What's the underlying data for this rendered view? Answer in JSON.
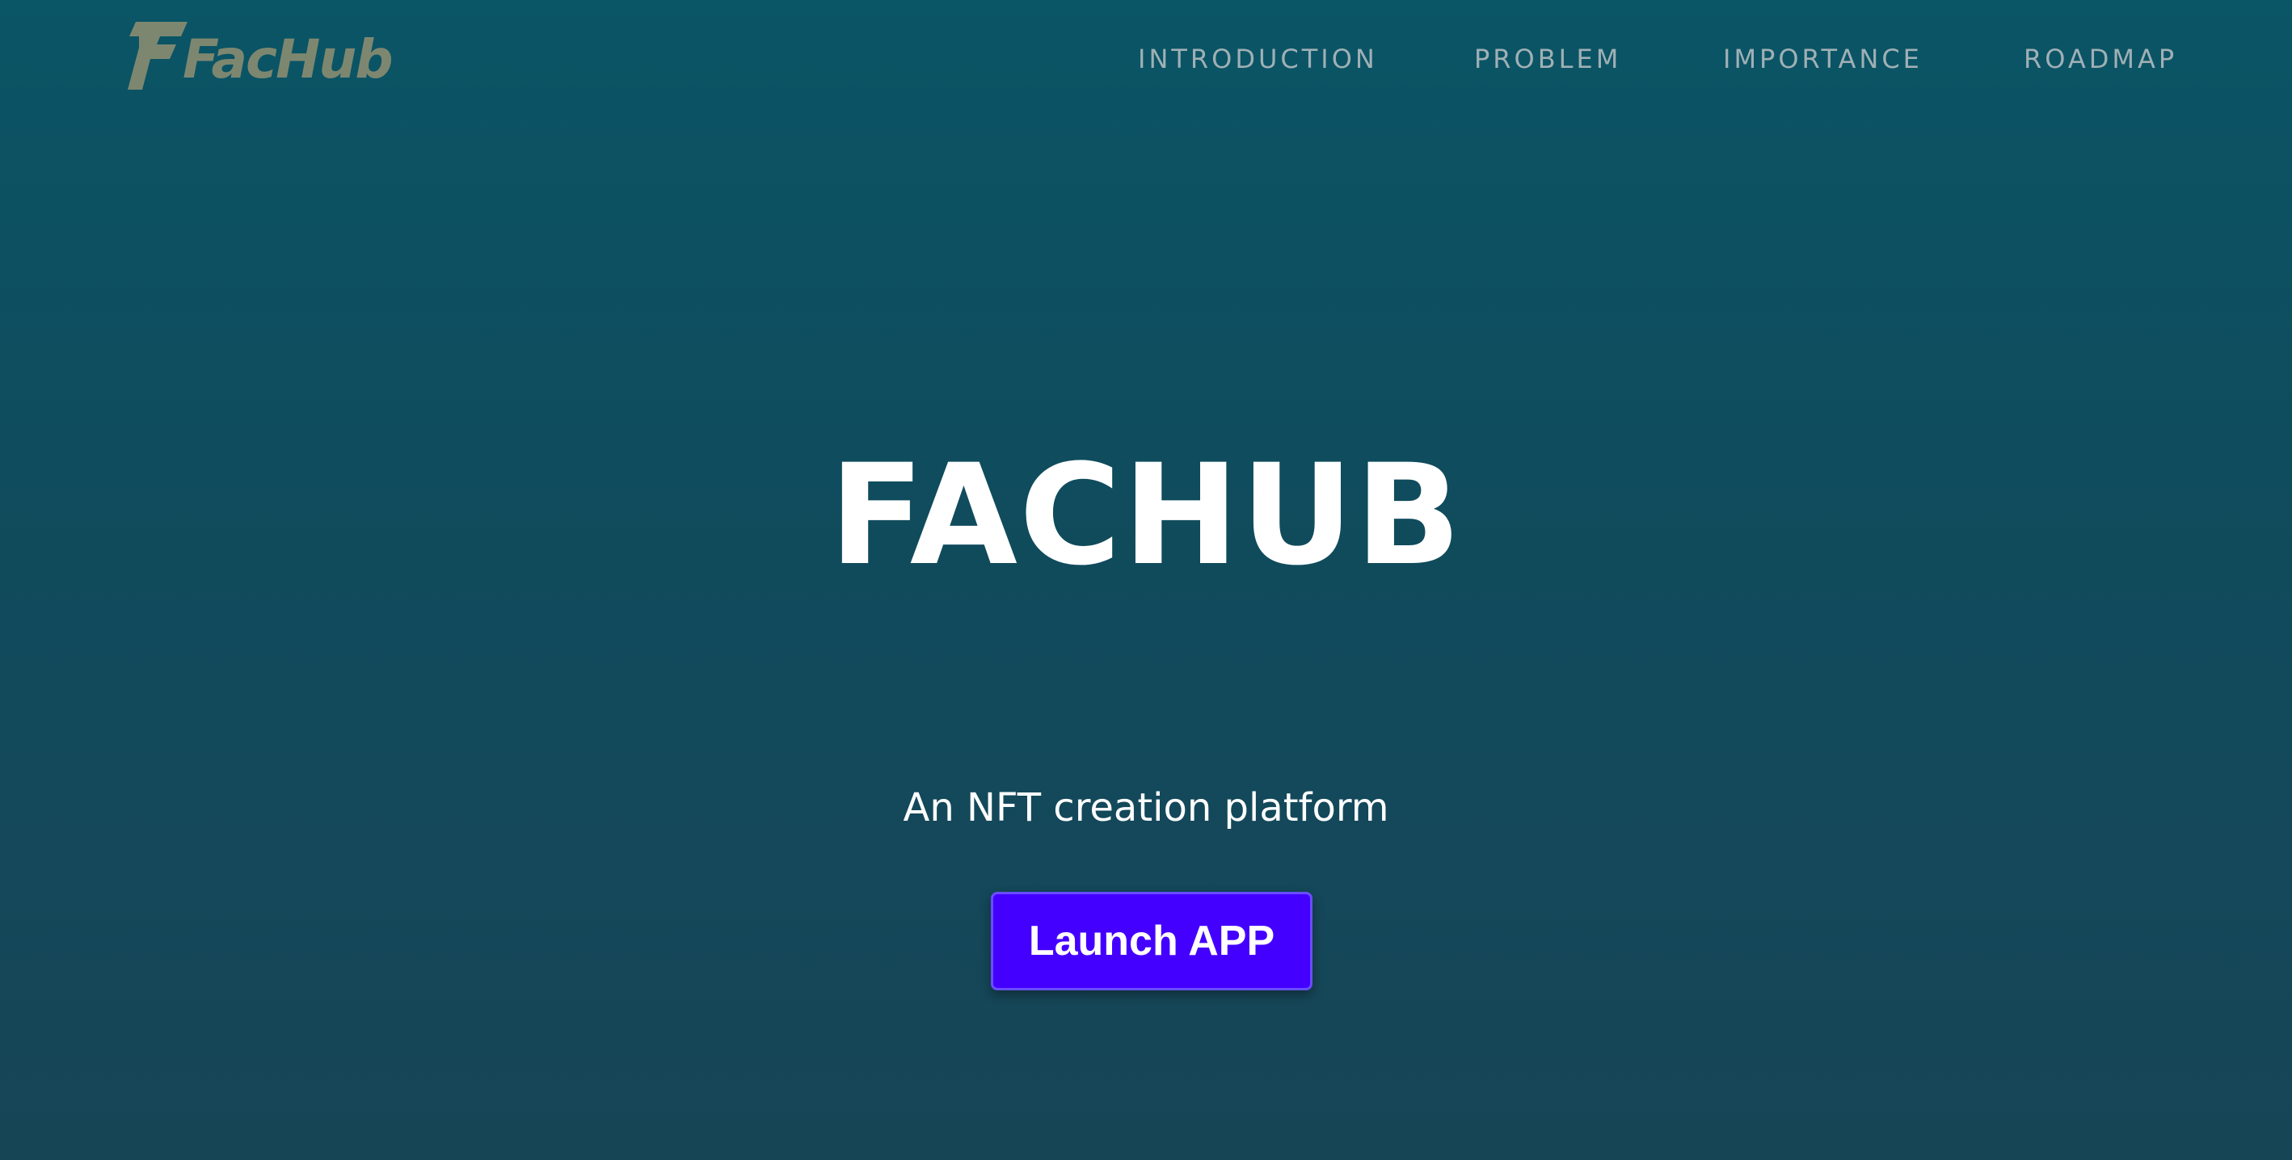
{
  "header": {
    "logo": {
      "text": "FacHub",
      "icon": "fachub-logo-icon",
      "color": "#7d8770"
    },
    "nav": [
      {
        "label": "INTRODUCTION"
      },
      {
        "label": "PROBLEM"
      },
      {
        "label": "IMPORTANCE"
      },
      {
        "label": "ROADMAP"
      }
    ]
  },
  "hero": {
    "title": "FACHUB",
    "subtitle": "An NFT creation platform",
    "cta_label": "Launch APP"
  },
  "colors": {
    "background_top": "#0a5566",
    "background_bottom": "#164556",
    "nav_text": "#9fb0b5",
    "cta_background": "#4400ff"
  }
}
